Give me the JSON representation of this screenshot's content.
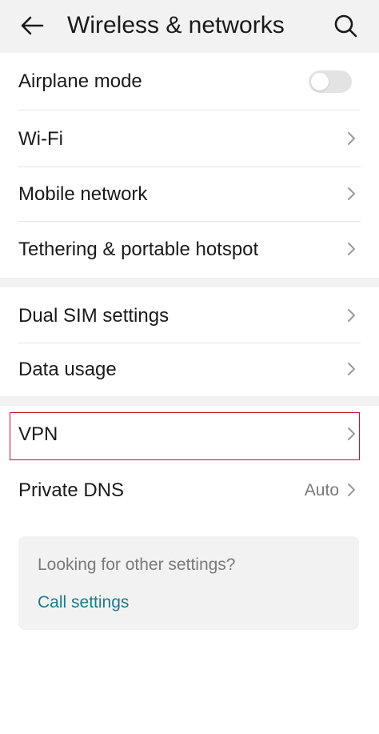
{
  "header": {
    "title": "Wireless & networks",
    "back_icon": "arrow-left-icon",
    "search_icon": "search-icon"
  },
  "rows": {
    "airplane": {
      "label": "Airplane mode",
      "toggle_on": false
    },
    "wifi": {
      "label": "Wi-Fi"
    },
    "mobile": {
      "label": "Mobile network"
    },
    "tethering": {
      "label": "Tethering & portable hotspot"
    },
    "dualsim": {
      "label": "Dual SIM settings"
    },
    "datausage": {
      "label": "Data usage"
    },
    "vpn": {
      "label": "VPN"
    },
    "dns": {
      "label": "Private DNS",
      "value": "Auto"
    }
  },
  "card": {
    "prompt": "Looking for other settings?",
    "link": "Call settings"
  },
  "colors": {
    "highlight": "#c8102e",
    "link": "#1f7a8c",
    "section_bg": "#f2f2f2"
  }
}
